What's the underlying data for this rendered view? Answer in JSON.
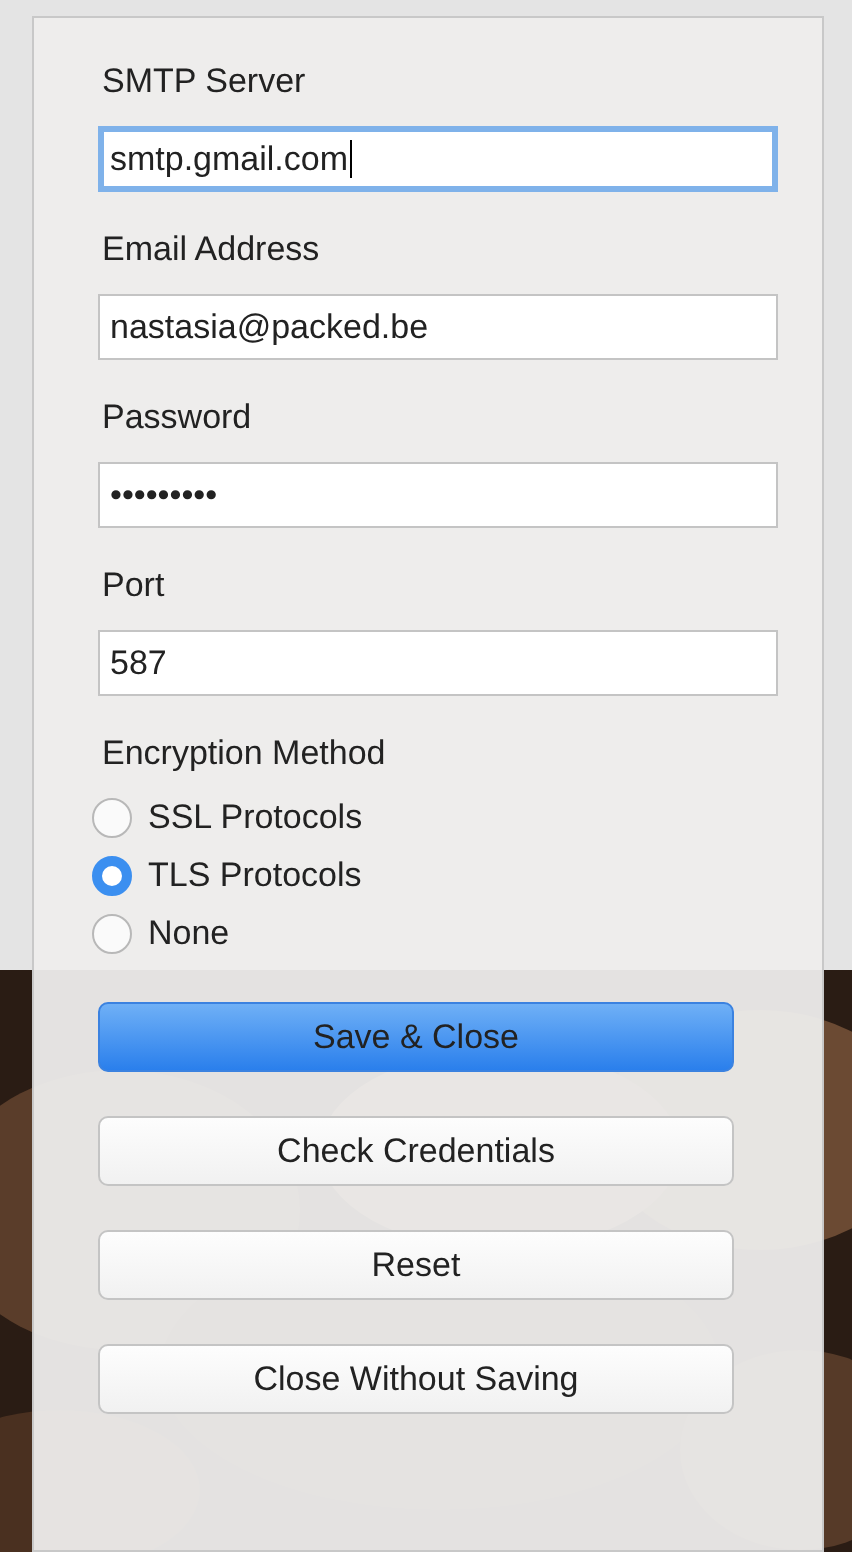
{
  "fields": [
    {
      "label": "SMTP Server",
      "value": "smtp.gmail.com",
      "focused": true
    },
    {
      "label": "Email Address",
      "value": "nastasia@packed.be",
      "focused": false
    },
    {
      "label": "Password",
      "value": "•••••••••",
      "focused": false
    },
    {
      "label": "Port",
      "value": "587",
      "focused": false
    }
  ],
  "encryption": {
    "label": "Encryption Method",
    "options": [
      {
        "label": "SSL Protocols",
        "selected": false
      },
      {
        "label": "TLS Protocols",
        "selected": true
      },
      {
        "label": "None",
        "selected": false
      }
    ]
  },
  "buttons": [
    {
      "label": "Save & Close",
      "default": true
    },
    {
      "label": "Check Credentials",
      "default": false
    },
    {
      "label": "Reset",
      "default": false
    },
    {
      "label": "Close Without Saving",
      "default": false
    }
  ]
}
